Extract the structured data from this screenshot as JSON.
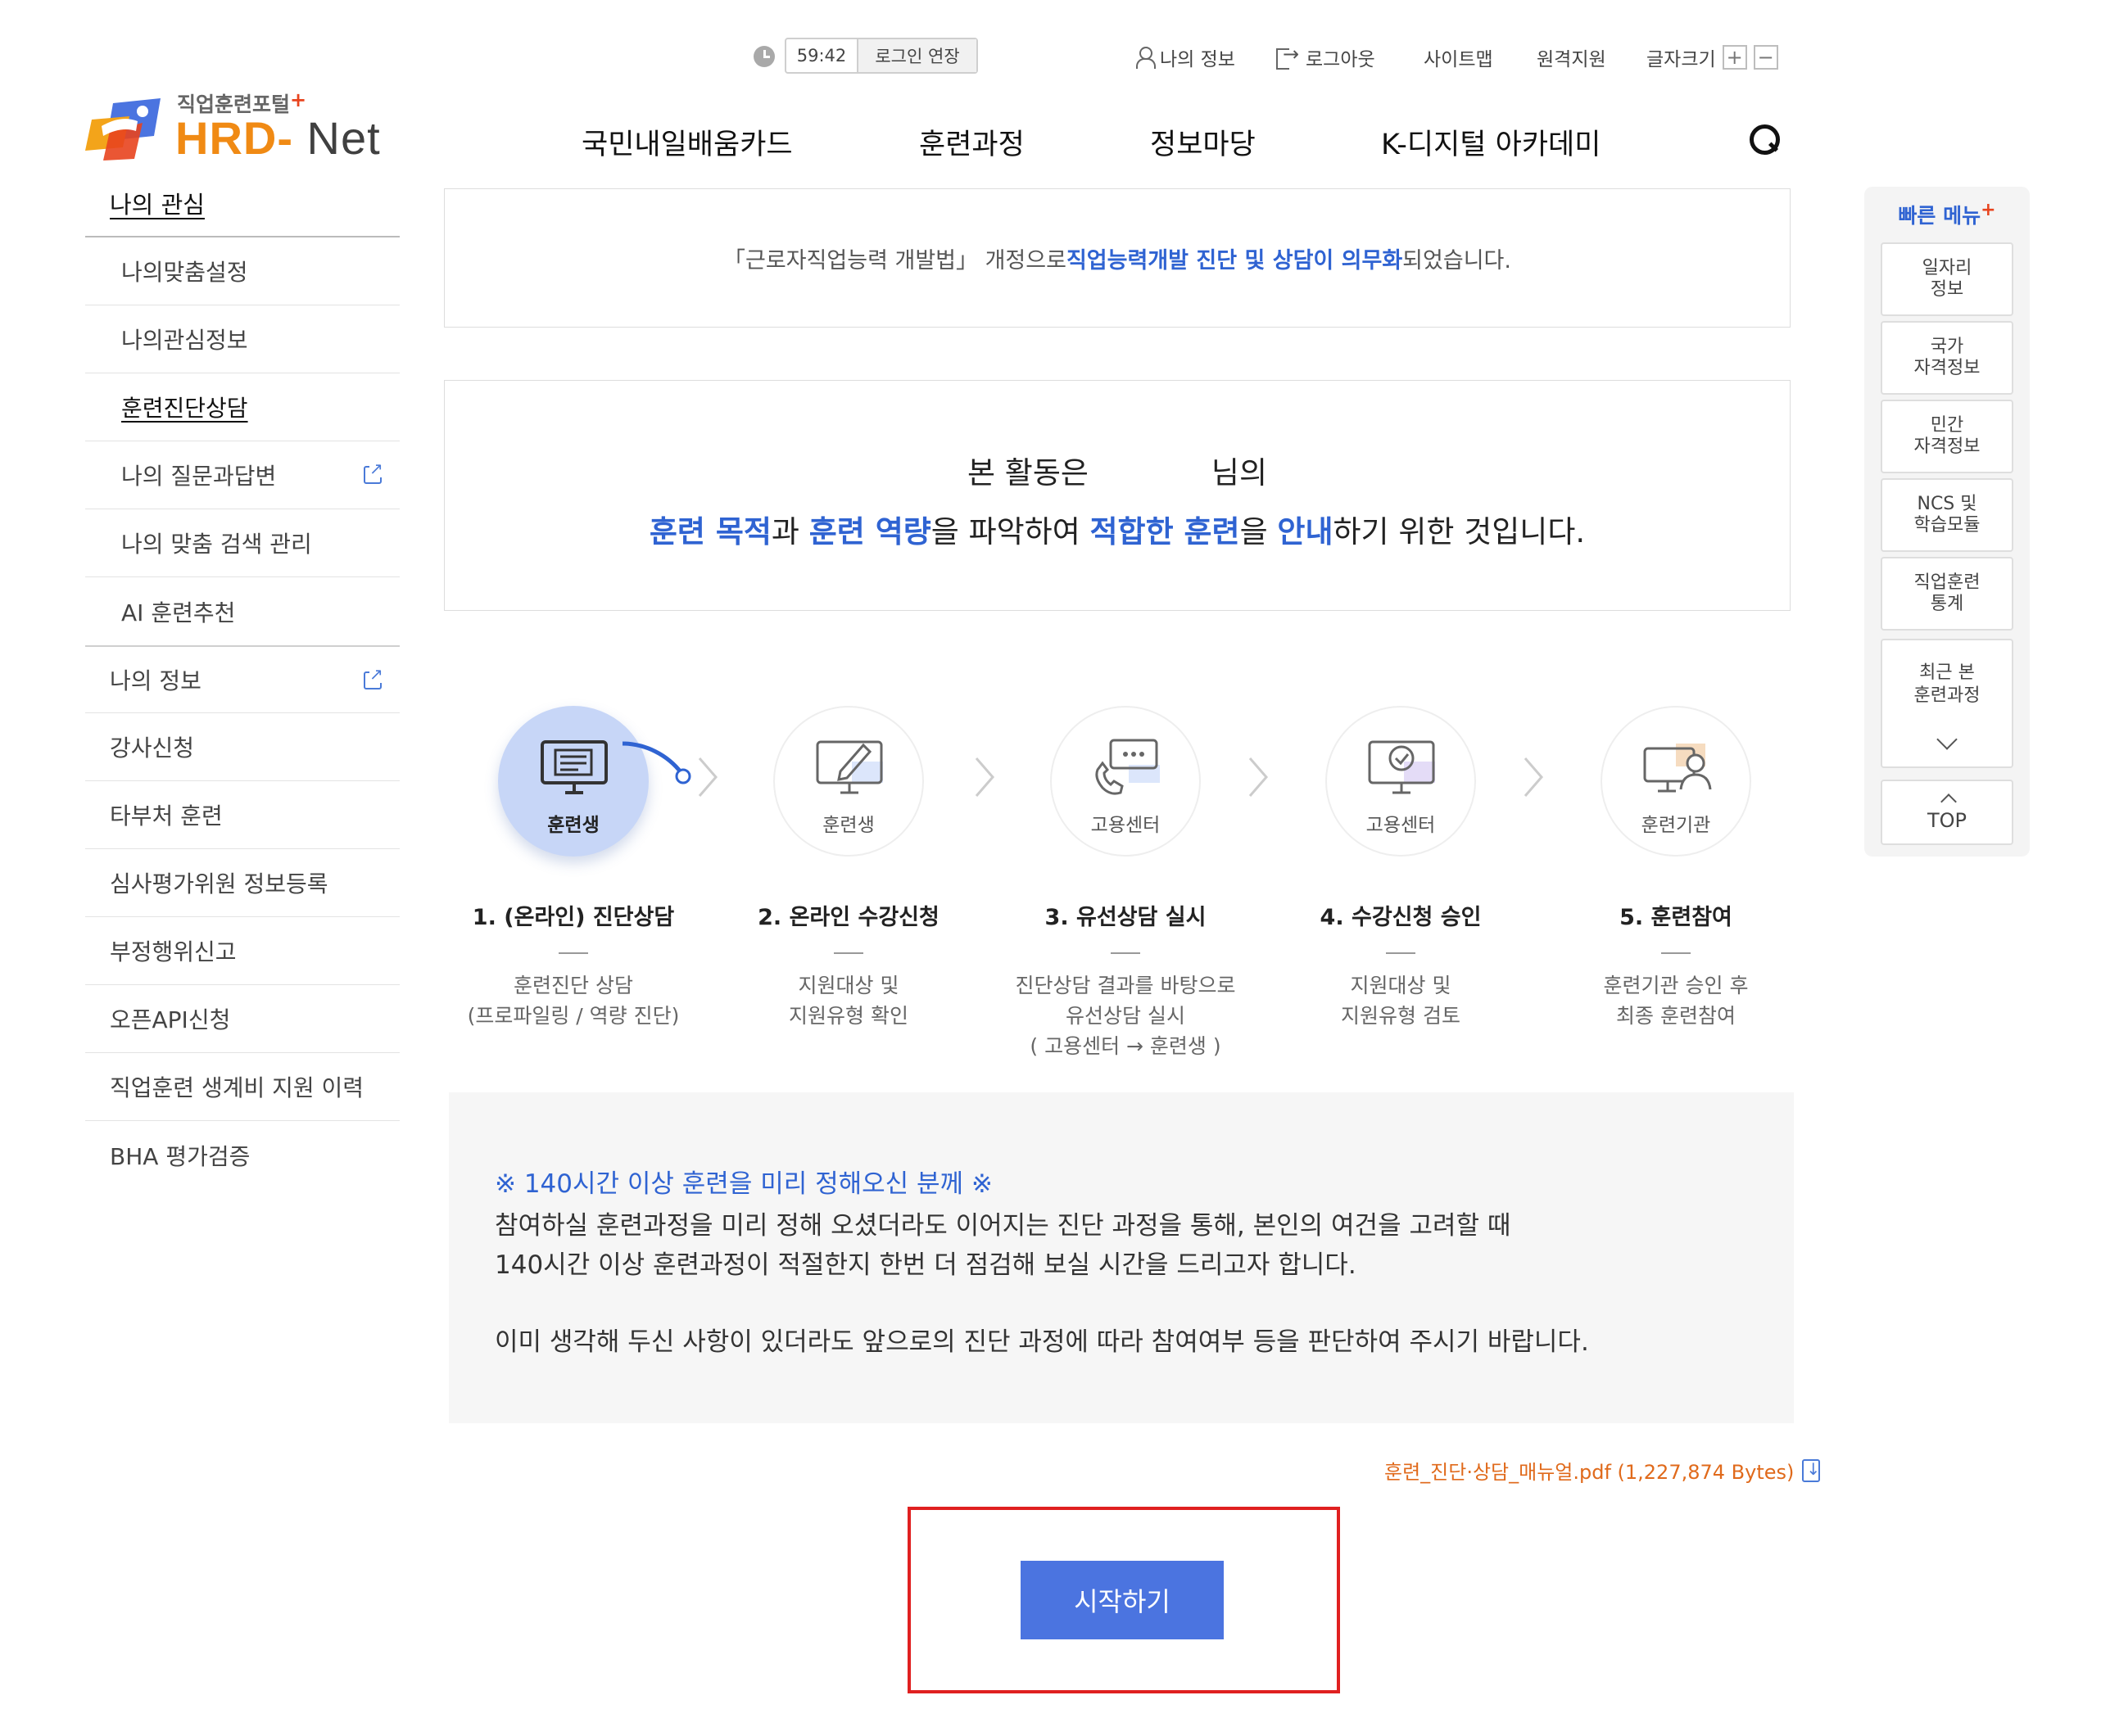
{
  "header": {
    "timer": "59:42",
    "extend_label": "로그인 연장",
    "my_info": "나의 정보",
    "logout": "로그아웃",
    "sitemap": "사이트맵",
    "remote": "원격지원",
    "font_size": "글자크기",
    "font_plus": "+",
    "font_minus": "−"
  },
  "logo": {
    "sub": "직업훈련포털",
    "plus": "+",
    "hrd": "HRD",
    "dash": "-",
    "net": "Net"
  },
  "gnb": [
    "국민내일배움카드",
    "훈련과정",
    "정보마당",
    "K-디지털 아카데미"
  ],
  "sidebar": {
    "section": "나의 관심",
    "sub_items": [
      "나의맞춤설정",
      "나의관심정보",
      "훈련진단상담",
      "나의 질문과답변",
      "나의 맞춤 검색 관리",
      "AI 훈련추천"
    ],
    "active_sub": "훈련진단상담",
    "items": [
      "나의 정보",
      "강사신청",
      "타부처 훈련",
      "심사평가위원 정보등록",
      "부정행위신고",
      "오픈API신청",
      "직업훈련 생계비 지원 이력",
      "BHA 평가검증"
    ]
  },
  "notice": {
    "prefix": "「근로자직업능력 개발법」 개정으로 ",
    "highlight": "직업능력개발 진단 및 상담이 의무화",
    "suffix": " 되었습니다."
  },
  "intro": {
    "line1_a": "본 활동은",
    "line1_b": "님의",
    "p1": "훈련 목적",
    "t1": "과 ",
    "p2": "훈련 역량",
    "t2": "을 파악하여 ",
    "p3": "적합한 훈련",
    "t3": "을 ",
    "p4": "안내",
    "t4": "하기 위한 것입니다."
  },
  "steps": [
    {
      "who": "훈련생",
      "title": "1. (온라인) 진단상담",
      "desc1": "훈련진단 상담",
      "desc2": "(프로파일링 / 역량 진단)",
      "desc3": "",
      "icon": "monitor-doc-icon"
    },
    {
      "who": "훈련생",
      "title": "2. 온라인 수강신청",
      "desc1": "지원대상 및",
      "desc2": "지원유형 확인",
      "desc3": "",
      "icon": "monitor-pen-icon"
    },
    {
      "who": "고용센터",
      "title": "3. 유선상담 실시",
      "desc1": "진단상담 결과를 바탕으로",
      "desc2": "유선상담 실시",
      "desc3": "( 고용센터 → 훈련생 )",
      "icon": "phone-chat-icon"
    },
    {
      "who": "고용센터",
      "title": "4. 수강신청 승인",
      "desc1": "지원대상 및",
      "desc2": "지원유형 검토",
      "desc3": "",
      "icon": "monitor-check-icon"
    },
    {
      "who": "훈련기관",
      "title": "5. 훈련참여",
      "desc1": "훈련기관 승인 후",
      "desc2": "최종 훈련참여",
      "desc3": "",
      "icon": "monitor-person-icon"
    }
  ],
  "info": {
    "title": "※ 140시간 이상 훈련을 미리 정해오신 분께 ※",
    "line1": "참여하실 훈련과정을 미리 정해 오셨더라도 이어지는 진단 과정을 통해, 본인의 여건을 고려할 때",
    "line2": "140시간 이상 훈련과정이 적절한지 한번 더 점검해 보실 시간을 드리고자 합니다.",
    "line3": "이미 생각해 두신 사항이 있더라도 앞으로의 진단 과정에 따라 참여여부 등을 판단하여 주시기 바랍니다."
  },
  "file": {
    "label": "훈련_진단·상담_매뉴얼.pdf (1,227,874 Bytes)"
  },
  "start_button": "시작하기",
  "quick_menu": {
    "title": "빠른 메뉴",
    "plus": "+",
    "items": [
      "일자리\n정보",
      "국가\n자격정보",
      "민간\n자격정보",
      "NCS 및\n학습모듈",
      "직업훈련\n통계"
    ],
    "recent": "최근 본\n훈련과정",
    "top": "TOP"
  },
  "colors": {
    "accent": "#2f63d2",
    "button": "#4b74e0",
    "file_link": "#e06a1b",
    "highlight_frame": "#e02020",
    "logo_orange": "#f08a14"
  }
}
